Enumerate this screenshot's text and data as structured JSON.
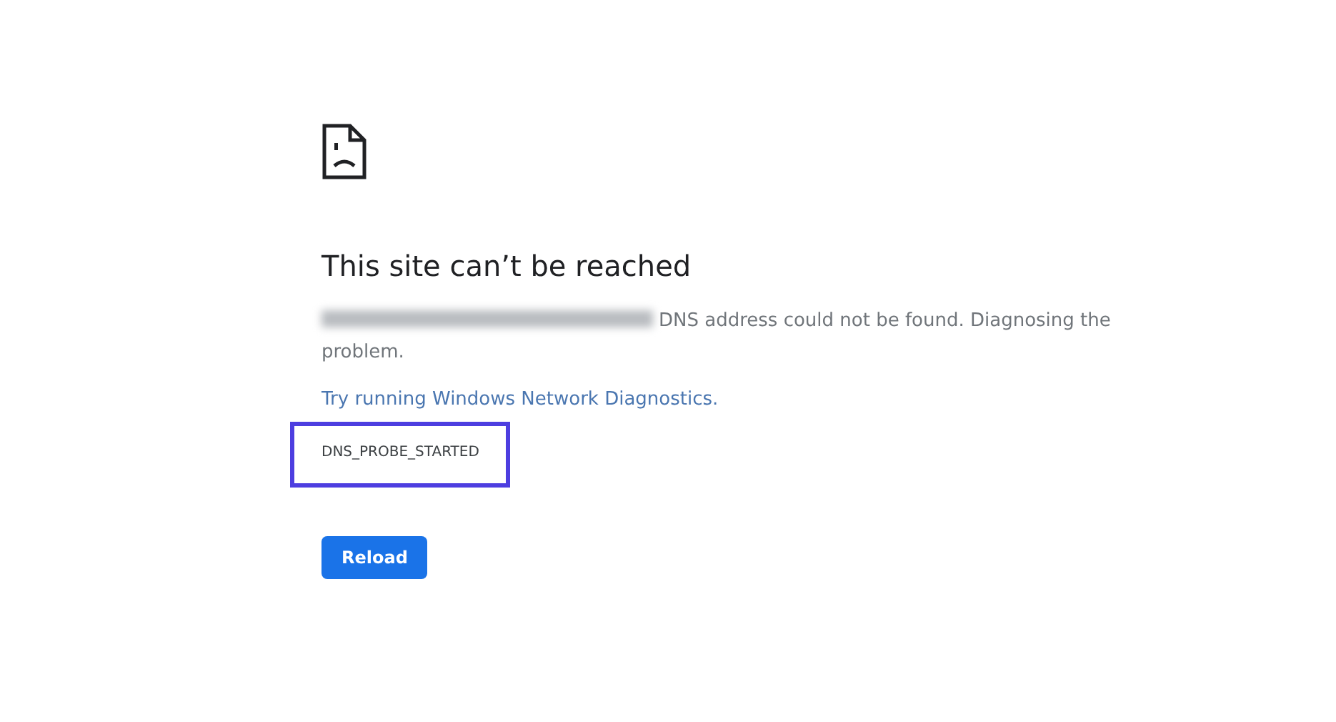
{
  "heading": "This site can’t be reached",
  "message": {
    "address_blurred": true,
    "text": "DNS address could not be found. Diagnosing the problem."
  },
  "link": "Try running Windows Network Diagnostics.",
  "error_code": {
    "text": "DNS_PROBE_STARTED",
    "highlighted": true
  },
  "buttons": [
    "Reload"
  ]
}
